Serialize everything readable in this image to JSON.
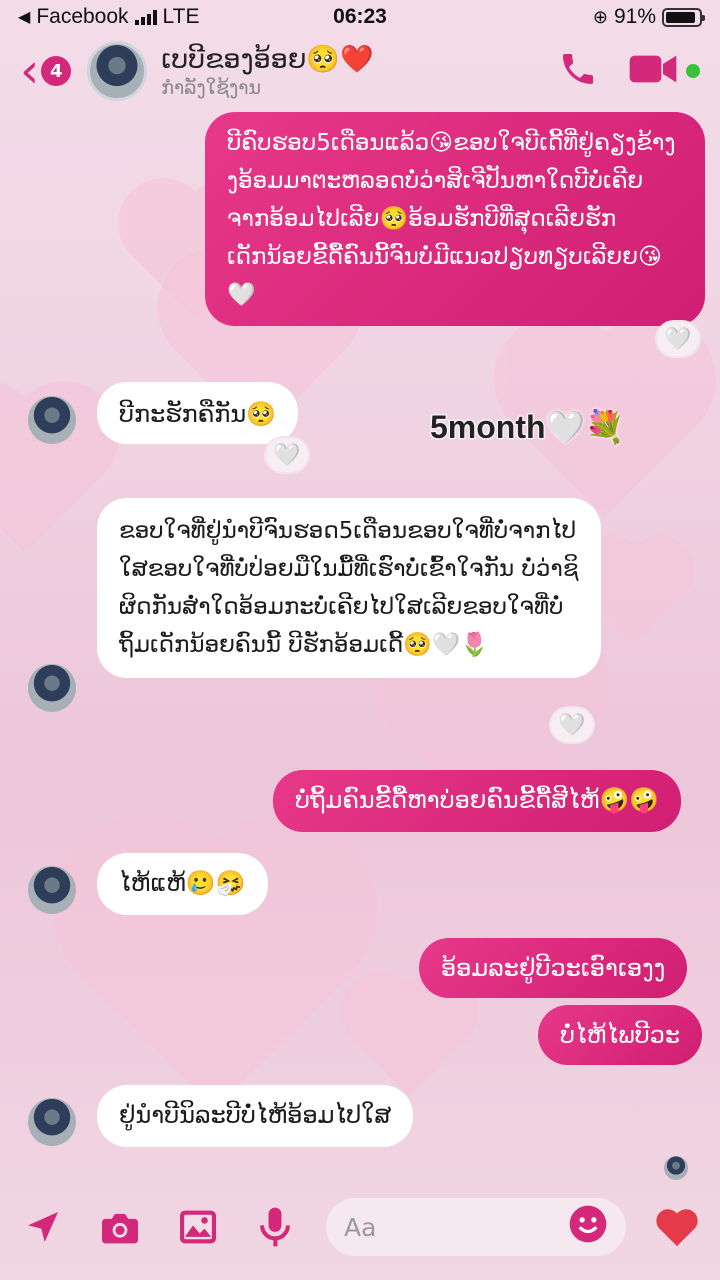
{
  "status_bar": {
    "carrier": "Facebook",
    "network": "LTE",
    "time": "06:23",
    "battery_text": "91%",
    "battery_level": 0.91
  },
  "header": {
    "back_count": "4",
    "contact_name": "ເບບີຂອງອ້ອຍ🥺❤️",
    "contact_status": "ກຳລັງໃຊ້ງານ",
    "accent_color": "#d4287a"
  },
  "messages": [
    {
      "direction": "out",
      "text": "ບີຄົບຮອບ5ເດືອນແລ້ວ😘ຂອບໃຈບີເດີ້ທີ່ຢູ່ຄຽງຂ້າງງອ້ອມມາຕະຫລອດບໍ່ວ່າສິເຈີປັນຫາໃດບີບໍ່ເຄີຍຈາກອ້ອມໄປເລີຍ🥺ອ້ອມຮັກບີທີ່ສຸດເລີຍຮັກເດັກນ້ອຍຂີ້ດື້ຄົນນີ້ຈົນບໍ່ມີແນວປຽບທຽບເລີຍຍ😘🤍",
      "reaction": "🤍"
    },
    {
      "direction": "in",
      "text": "ບີກະຮັກຄືກັນ🥺",
      "reaction": "🤍"
    },
    {
      "direction": "in",
      "text": "ຂອບໃຈທີ່ຢູ່ນຳບີຈົນຮອດ5ເດືອນຂອບໃຈທີ່ບໍ່ຈາກໄປໃສຂອບໃຈທີ່ບໍ່ປ່ອຍມືໃນມື້ທີ່ເຮົາບໍ່ເຂົ້າໃຈກັນ ບໍ່ວ່າຊິຜິດກັນສໍ່າໃດອ້ອມກະບໍ່ເຄີຍໄປໃສເລີຍຂອບໃຈທີ່ບໍ່ຖິ້ມເດັກນ້ອຍຄົນນີ້ ບີຮັກອ້ອມເດີ້🥺🤍🌷",
      "reaction": "🤍"
    },
    {
      "direction": "out",
      "text": "ບໍ່ຖິ້ມຄົນຂີ້ດື້ຫາບ່ອຍຄົນຂີ້ດື້ສີໄຫ້🤪🤪"
    },
    {
      "direction": "in",
      "text": "ໄຫ້ແຫ້🥲🤧"
    },
    {
      "direction": "out",
      "text": "ອ້ອມລະຢູ່ບີວະເອົາເອງງ"
    },
    {
      "direction": "out",
      "text": "ບໍ່ໄຫ້ໄພບີວະ"
    },
    {
      "direction": "in",
      "text": "ຢູ່ນຳບີນິລະບີບໍ່ໄຫ້ອ້ອມໄປໃສ"
    }
  ],
  "overlay": {
    "text": "5month🤍💐"
  },
  "composer": {
    "placeholder": "Aa"
  }
}
